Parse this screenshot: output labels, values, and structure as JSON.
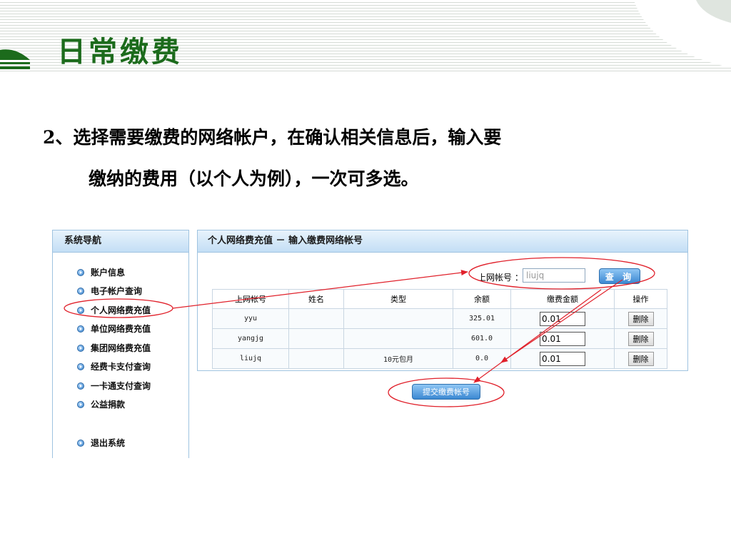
{
  "slide": {
    "title": "日常缴费",
    "body_line1": "2、选择需要缴费的网络帐户，在确认相关信息后，输入要",
    "body_line2": "缴纳的费用（以个人为例），一次可多选。"
  },
  "colors": {
    "title_green": "#1c6b1c",
    "panel_border": "#9fc3e0",
    "button_blue": "#3c88d2",
    "annotation_red": "#e0202a"
  },
  "nav": {
    "header": "系统导航",
    "items": [
      {
        "label": "账户信息"
      },
      {
        "label": "电子帐户查询"
      },
      {
        "label": "个人网络费充值"
      },
      {
        "label": "单位网络费充值"
      },
      {
        "label": "集团网络费充值"
      },
      {
        "label": "经费卡支付查询"
      },
      {
        "label": "一卡通支付查询"
      },
      {
        "label": "公益捐款"
      },
      {
        "label": "退出系统"
      }
    ],
    "item_icon": "arrow-bullet-icon"
  },
  "main": {
    "header": "个人网络费充值 － 输入缴费网络帐号",
    "account_label": "上网帐号 ：",
    "account_value": "liujq",
    "query_label": "查 询",
    "columns": [
      "上网帐号",
      "姓名",
      "类型",
      "余额",
      "缴费金额",
      "操作"
    ],
    "rows": [
      {
        "account": "yyu",
        "name": "",
        "type": "",
        "balance": "325.01",
        "amount": "0.01",
        "action": "删除"
      },
      {
        "account": "yangjg",
        "name": "",
        "type": "",
        "balance": "601.0",
        "amount": "0.01",
        "action": "删除"
      },
      {
        "account": "liujq",
        "name": "",
        "type": "10元包月",
        "balance": "0.0",
        "amount": "0.01",
        "action": "删除"
      }
    ],
    "submit_label": "提交缴费帐号"
  }
}
